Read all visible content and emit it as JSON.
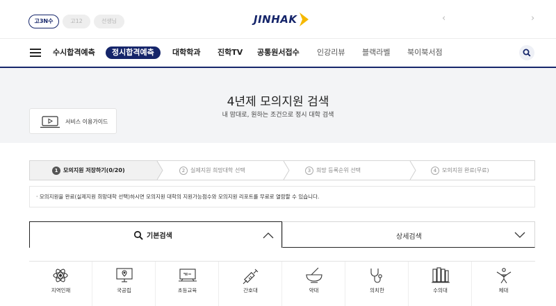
{
  "header": {
    "pills": [
      "고3N수",
      "고12",
      "선생님"
    ],
    "logo": "JINHAK",
    "prev_arrow": "‹",
    "next_arrow": "›"
  },
  "nav": {
    "items": [
      "수시합격예측",
      "정시합격예측",
      "대학학과",
      "진학TV",
      "공통원서접수",
      "인강리뷰",
      "블랙라벨",
      "북이북서점"
    ],
    "selected_index": 1
  },
  "hero": {
    "title": "4년제 모의지원 검색",
    "subtitle": "내 맘대로, 원하는 조건으로 정시 대학 검색",
    "guide_button": "서비스 이용가이드"
  },
  "steps": [
    {
      "num": "1",
      "label": "모의지원 저장하기(0/20)",
      "active": true
    },
    {
      "num": "2",
      "label": "실제지원 희망대학 선택",
      "active": false
    },
    {
      "num": "3",
      "label": "희망 등록순위 선택",
      "active": false
    },
    {
      "num": "4",
      "label": "모의지원 완료(무료)",
      "active": false
    }
  ],
  "notice": "· 모의지원을 완료(실제지원 희망대학 선택)하시면 모의지원 대학의 지원가능점수와 모의지원 리포트를 무료로 열람할 수 있습니다.",
  "search_tabs": {
    "basic": "기본검색",
    "detail": "상세검색"
  },
  "categories": [
    {
      "label": "지역인재",
      "icon": "atom-icon"
    },
    {
      "label": "국공립",
      "icon": "monitor-pin-icon"
    },
    {
      "label": "초등교육",
      "icon": "blackboard-icon"
    },
    {
      "label": "간호대",
      "icon": "syringe-icon"
    },
    {
      "label": "약대",
      "icon": "mortar-pestle-icon"
    },
    {
      "label": "의치한",
      "icon": "stethoscope-icon"
    },
    {
      "label": "수의대",
      "icon": "books-icon"
    },
    {
      "label": "체대",
      "icon": "athlete-icon"
    }
  ],
  "colors": {
    "brand_navy": "#15256a",
    "logo_arrow": "#f5b800",
    "hero_bg": "#f3f4f6"
  }
}
